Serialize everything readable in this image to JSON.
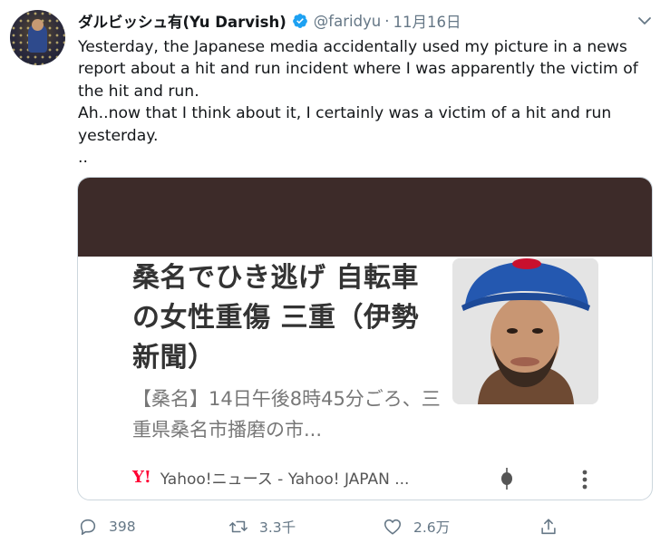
{
  "tweet": {
    "author_name": "ダルビッシュ有(Yu Darvish)",
    "handle": "@faridyu",
    "separator": "·",
    "date": "11月16日",
    "text": "Yesterday, the Japanese media accidentally used my picture in a news report about a hit and run incident where I was apparently the victim of the hit and run.\nAh..now that I think about it, I certainly was a victim of a hit and run yesterday.\n..",
    "icons": {
      "verified": "verified-badge-icon",
      "menu": "chevron-down-icon"
    }
  },
  "card": {
    "headline": "桑名でひき逃げ 自転車の女性重傷 三重（伊勢新聞）",
    "excerpt": "【桑名】14日午後8時45分ごろ、三重県桑名市播磨の市...",
    "logo_text": "Y!",
    "source": "Yahoo!ニュース - Yahoo! JAPAN ...",
    "colors": {
      "band": "#3d2b29",
      "yahoo_red": "#ff0033"
    }
  },
  "actions": {
    "reply_count": "398",
    "retweet_count": "3.3千",
    "like_count": "2.6万"
  },
  "colors": {
    "verified_blue": "#1da1f2",
    "secondary_text": "#657786"
  }
}
